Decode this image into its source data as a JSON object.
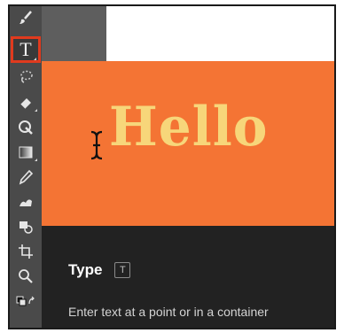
{
  "toolbar": {
    "tools": [
      {
        "icon": "brush-icon"
      },
      {
        "icon": "type-tool-icon",
        "label": "T",
        "selected": true
      },
      {
        "icon": "lasso-icon"
      },
      {
        "icon": "eraser-icon"
      },
      {
        "icon": "spot-healing-icon"
      },
      {
        "icon": "gradient-icon"
      },
      {
        "icon": "eyedropper-icon"
      },
      {
        "icon": "clone-stamp-icon"
      },
      {
        "icon": "shape-tool-icon"
      },
      {
        "icon": "crop-icon"
      },
      {
        "icon": "zoom-icon"
      },
      {
        "icon": "swap-colors-icon"
      }
    ]
  },
  "tooltip": {
    "preview_text": "Hello",
    "title": "Type",
    "shortcut": "T",
    "description": "Enter text at a point or in a container"
  },
  "colors": {
    "toolbar_bg": "#4a4a4a",
    "highlight": "#e03a1e",
    "preview_bg": "#f47434",
    "preview_text": "#f7d67a",
    "card_bg": "#222222"
  }
}
